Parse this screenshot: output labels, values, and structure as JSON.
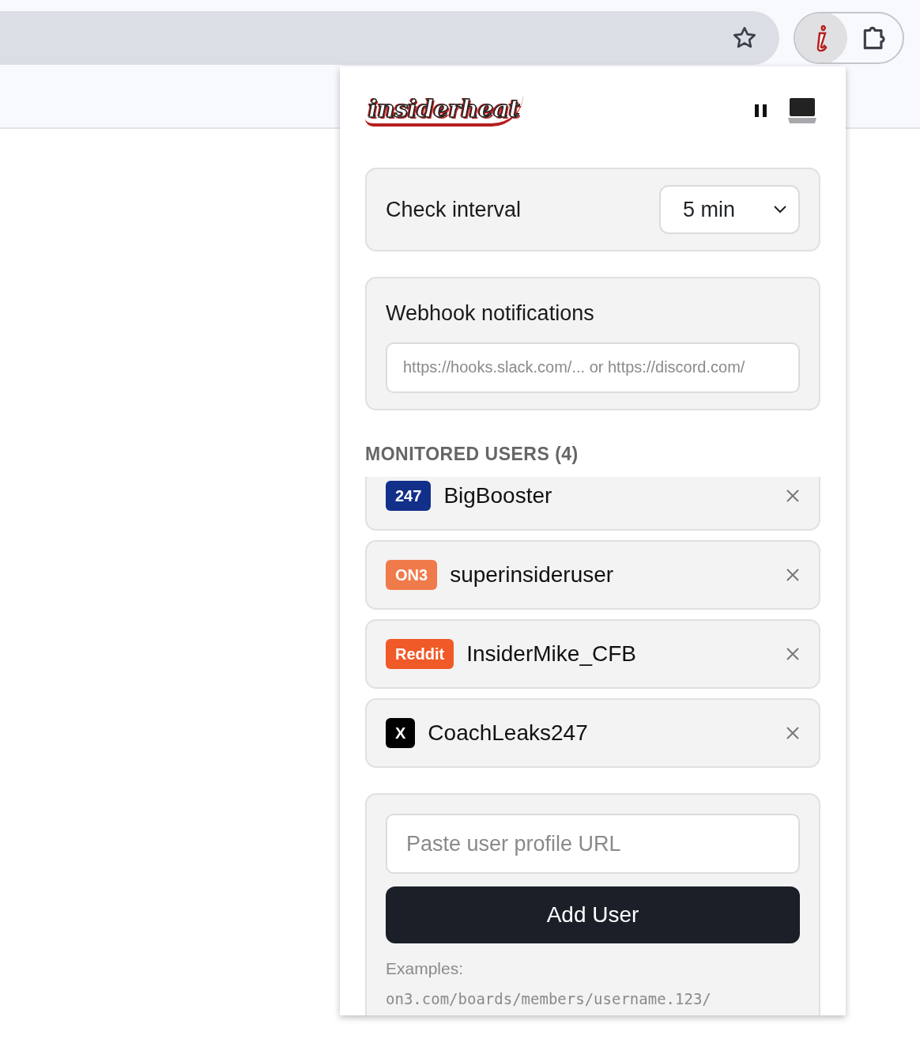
{
  "popup": {
    "logo": "insiderheat",
    "check_interval": {
      "label": "Check interval",
      "value": "5 min"
    },
    "webhook": {
      "label": "Webhook notifications",
      "placeholder": "https://hooks.slack.com/... or https://discord.com/"
    },
    "monitored_users": {
      "title": "MONITORED USERS (4)",
      "items": [
        {
          "source": "247",
          "name": "BigBooster",
          "color": "#12308a"
        },
        {
          "source": "ON3",
          "name": "superinsideruser",
          "color": "#f07b4a"
        },
        {
          "source": "Reddit",
          "name": "InsiderMike_CFB",
          "color": "#f05a28"
        },
        {
          "source": "X",
          "name": "CoachLeaks247",
          "color": "#000000"
        }
      ]
    },
    "add_user": {
      "placeholder": "Paste user profile URL",
      "button": "Add User",
      "examples_label": "Examples:",
      "examples": [
        "on3.com/boards/members/username.123/"
      ]
    }
  }
}
